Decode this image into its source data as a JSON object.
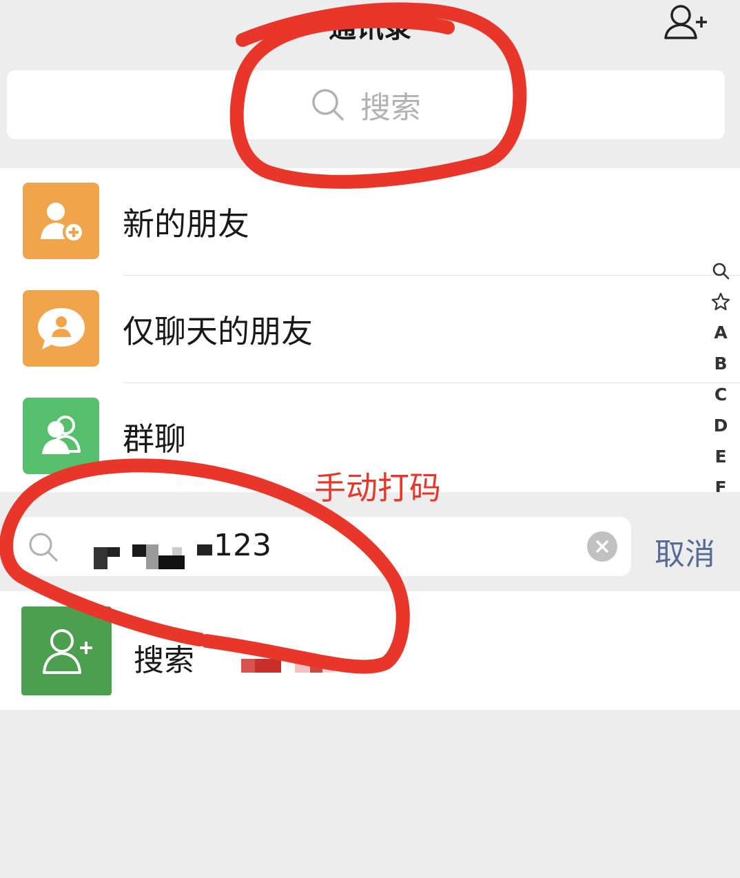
{
  "header": {
    "title": "通讯录",
    "add_icon": "add-contact-icon"
  },
  "top_search": {
    "placeholder": "搜索",
    "icon": "search-icon"
  },
  "list": {
    "items": [
      {
        "label": "新的朋友",
        "color": "#f0a54c",
        "icon": "new-friend-icon"
      },
      {
        "label": "仅聊天的朋友",
        "color": "#f0a54c",
        "icon": "chat-only-friend-icon"
      },
      {
        "label": "群聊",
        "color": "#56bf6e",
        "icon": "group-chat-icon"
      }
    ]
  },
  "index_bar": {
    "letters": [
      "A",
      "B",
      "C",
      "D",
      "E",
      "F"
    ]
  },
  "search": {
    "query_suffix": "123",
    "cancel_label": "取消",
    "icon": "search-icon"
  },
  "result": {
    "prefix": "搜索",
    "icon": "add-contact-icon",
    "color": "#4d9f50"
  },
  "annotation": {
    "text": "手动打码",
    "color": "#e8372a"
  }
}
